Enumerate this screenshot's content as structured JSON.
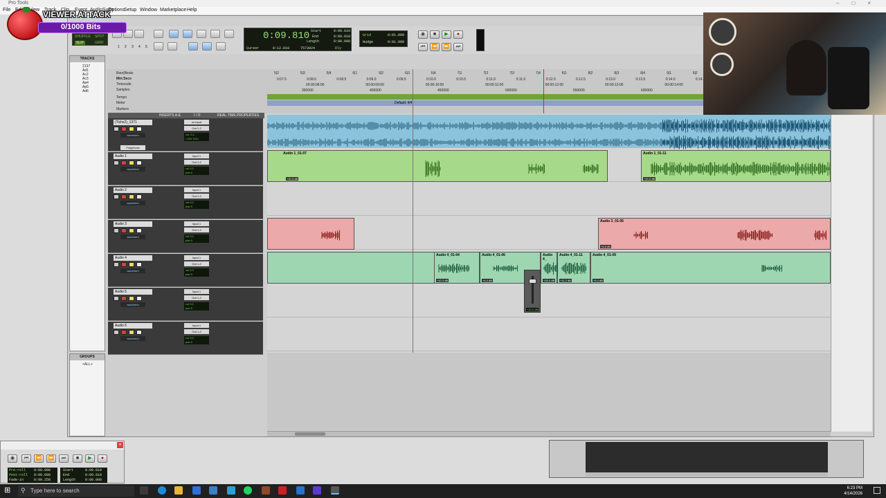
{
  "window": {
    "title": "Pro Tools"
  },
  "menu": [
    "File",
    "Edit",
    "View",
    "Track",
    "Clip",
    "Event",
    "AudioSuite",
    "Options",
    "Setup",
    "Window",
    "Marketplace",
    "Help"
  ],
  "overlay": {
    "title": "VIEWER ATTACK",
    "bits": "0/1000 Bits"
  },
  "toolbar": {
    "modes": [
      "SHUFFLE",
      "SPOT",
      "SLIP",
      "GRID"
    ],
    "nums": [
      "1",
      "2",
      "3",
      "4",
      "5"
    ]
  },
  "counter": {
    "main": "0:09.810",
    "start_label": "Start",
    "start": "0:09.810",
    "end_label": "End",
    "end": "0:09.810",
    "length_label": "Length",
    "length": "0:00.000",
    "cursor_label": "Cursor",
    "cursor": "0:12.010",
    "samples": "7573024",
    "dly": "Dly"
  },
  "grid": {
    "grid_label": "Grid",
    "grid_value": "0:01.000",
    "nudge_label": "Nudge",
    "nudge_value": "0:01.000"
  },
  "tracks_panel": {
    "title": "TRACKS",
    "items": [
      "2137",
      "Ad1",
      "Ac2",
      "Ac3",
      "Ap4",
      "Ap5",
      "Ad6"
    ]
  },
  "groups_panel": {
    "title": "GROUPS",
    "items": [
      "<ALL>"
    ]
  },
  "rulers": {
    "labels": [
      "Bars|Beats",
      "Min:Secs",
      "Timecode",
      "Samples",
      "Tempo",
      "Meter",
      "Markers"
    ],
    "bars": [
      "5|2",
      "5|3",
      "5|4",
      "6|1",
      "6|2",
      "6|3",
      "6|4",
      "7|1",
      "7|2",
      "7|3",
      "7|4",
      "8|1",
      "8|2",
      "8|3",
      "8|4",
      "9|1",
      "9|2"
    ],
    "minsecs": [
      "0:07.5",
      "0:08.0",
      "0:08.5",
      "0:09.0",
      "0:09.5",
      "0:10.0",
      "0:10.5",
      "0:11.0",
      "0:11.5",
      "0:12.0",
      "0:12.5",
      "0:13.0",
      "0:13.5",
      "0:14.0",
      "0:14.5"
    ],
    "timecode": [
      "00:00:08:00",
      "00:00:09:00",
      "00:00:10:00",
      "00:00:11:00",
      "00:00:12:00",
      "00:00:13:00",
      "00:00:14:00"
    ],
    "samples": [
      "350000",
      "400000",
      "450000",
      "500000",
      "550000",
      "600000"
    ],
    "meter_value": "Default: 4/4"
  },
  "columns": {
    "inserts": "INSERTS A-E",
    "io": "I / O",
    "rtp": "REAL-TIME PROPERTIES"
  },
  "tracks": [
    {
      "name": "(Tichx2)_1371",
      "input": "no input",
      "output": "Out 1-2",
      "vol": "vol -0.1",
      "pan": "<100 100>",
      "view": "waveform",
      "extra": "Polyphonic"
    },
    {
      "name": "Audio 1",
      "input": "Input 1",
      "output": "Out 1-2",
      "vol": "vol 0.0",
      "pan": "pan 0",
      "view": "waveform"
    },
    {
      "name": "Audio 2",
      "input": "Input 1",
      "output": "Out 1-2",
      "vol": "vol 0.0",
      "pan": "pan 0",
      "view": "waveform"
    },
    {
      "name": "Audio 3",
      "input": "Input 1",
      "output": "Out 1-2",
      "vol": "vol 0.0",
      "pan": "pan 0",
      "view": "waveform"
    },
    {
      "name": "Audio 4",
      "input": "Input 1",
      "output": "Out 1-2",
      "vol": "vol 0.0",
      "pan": "pan 0",
      "view": "waveform"
    },
    {
      "name": "Audio 5",
      "input": "Input 1",
      "output": "Out 1-2",
      "vol": "vol 0.0",
      "pan": "pan 0",
      "view": "waveform"
    },
    {
      "name": "Audio 6",
      "input": "Input 1",
      "output": "Out 1-2",
      "vol": "vol 0.0",
      "pan": "pan 0",
      "view": "waveform"
    }
  ],
  "clips": {
    "a1_1": "Audio 1_01-07",
    "a1_1_vol": "+10.3 dB",
    "a1_2": "Audio 1_01-11",
    "a1_2_vol": "+10.3 dB",
    "a3_2": "Audio 3_01-05",
    "a3_2_vol": "+6.8 dB",
    "a4_1": "Audio 4_01-04",
    "a4_1_vol": "+10.3 dB",
    "a4_2": "Audio 4_01-06",
    "a4_2_vol": "+4.4 dB",
    "a4_3": "Audio 4_",
    "a4_3_vol": "+15.0 dB",
    "a4_4": "Audio 4_01-11",
    "a4_4_vol": "+11.2 dB",
    "a4_5": "Audio 4_01-09",
    "a4_5_vol": "+4.4 dB",
    "fader_value": "+15.0 dB"
  },
  "transport": {
    "preroll_label": "Pre-roll",
    "preroll": "0:00.000",
    "postroll_label": "Post-roll",
    "postroll": "0:00.000",
    "fadein_label": "Fade-in",
    "fadein": "0:00.250",
    "start_label": "Start",
    "start": "0:09.810",
    "end_label": "End",
    "end": "0:09.810",
    "length_label": "Length",
    "length": "0:00.000"
  },
  "taskbar": {
    "search_placeholder": "Type here to search",
    "time": "6:23 PM",
    "date": "4/14/2026"
  }
}
